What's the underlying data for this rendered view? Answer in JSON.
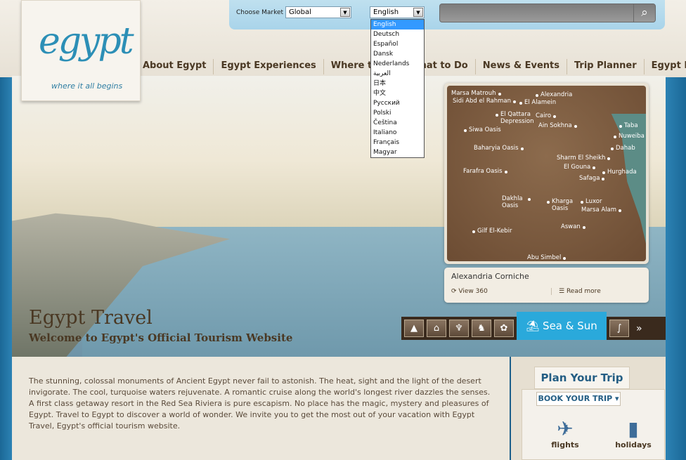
{
  "logo": {
    "word": "egypt",
    "tagline": "where it all begins"
  },
  "market": {
    "label": "Choose Market",
    "market_value": "Global",
    "language_value": "English"
  },
  "languages": [
    "English",
    "Deutsch",
    "Español",
    "Dansk",
    "Nederlands",
    "العربية",
    "日本",
    "中文",
    "Русский",
    "Polski",
    "Čeština",
    "Italiano",
    "Français",
    "Magyar"
  ],
  "nav": [
    "About Egypt",
    "Egypt Experiences",
    "Where to Go",
    "What to Do",
    "News & Events",
    "Trip Planner",
    "Egypt Now"
  ],
  "hero": {
    "title": "Egypt Travel",
    "subtitle": "Welcome to Egypt's Official Tourism Website"
  },
  "map": {
    "places": [
      "Marsa Matrouh",
      "Alexandria",
      "Sidi Abd el Rahman",
      "El Alamein",
      "El Qattara Depression",
      "Cairo",
      "Ain Sokhna",
      "Taba",
      "Siwa Oasis",
      "Nuweiba",
      "Dahab",
      "Baharyia Oasis",
      "Sharm El Sheikh",
      "El Gouna",
      "Hurghada",
      "Farafra Oasis",
      "Safaga",
      "Dakhla Oasis",
      "Kharga Oasis",
      "Luxor",
      "Marsa Alam",
      "Aswan",
      "Gilf El-Kebir",
      "Abu Simbel"
    ]
  },
  "caption": {
    "title": "Alexandria Corniche",
    "view360": "View 360",
    "read_more": "Read more"
  },
  "tabs": {
    "active": "Sea & Sun"
  },
  "intro": "The stunning, colossal monuments of Ancient Egypt never fail to astonish. The heat, sight and the light of the desert invigorate. The cool, turquoise waters rejuvenate. A romantic cruise along the world's longest river dazzles the senses. A first class getaway resort in the Red Sea Riviera is pure escapism. No place has the magic, mystery and pleasures of Egypt. Travel to Egypt to discover a world of wonder. We invite you to get the most out of your vacation with Egypt Travel, Egypt's official tourism website.",
  "plan": {
    "title": "Plan Your Trip",
    "book": "BOOK YOUR TRIP",
    "flights": "flights",
    "holidays": "holidays"
  }
}
